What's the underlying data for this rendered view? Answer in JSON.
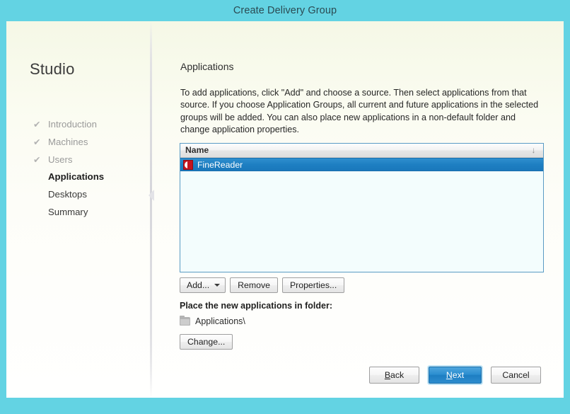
{
  "window": {
    "title": "Create Delivery Group",
    "titlebar_color": "#63d3e3",
    "accent_color": "#2b8ed0"
  },
  "sidebar": {
    "product_title": "Studio",
    "check_glyph": "✔",
    "items": [
      {
        "label": "Introduction",
        "state": "done"
      },
      {
        "label": "Machines",
        "state": "done"
      },
      {
        "label": "Users",
        "state": "done"
      },
      {
        "label": "Applications",
        "state": "current"
      },
      {
        "label": "Desktops",
        "state": "pending"
      },
      {
        "label": "Summary",
        "state": "pending"
      }
    ]
  },
  "main": {
    "heading": "Applications",
    "description": "To add applications, click \"Add\" and choose a source. Then select applications from that source. If you choose Application Groups, all current and future applications in the selected groups will be added. You can also place new applications in a non-default folder and change application properties.",
    "listview": {
      "column_header": "Name",
      "sort_glyph": "↓",
      "rows": [
        {
          "name": "FineReader",
          "icon": "finereader-app-icon",
          "selected": true
        }
      ]
    },
    "buttons": {
      "add": "Add...",
      "remove": "Remove",
      "properties": "Properties..."
    },
    "folder_section": {
      "label": "Place the new applications in folder:",
      "icon": "folder-icon",
      "path": "Applications\\",
      "change_button": "Change..."
    }
  },
  "footer": {
    "back": "Back",
    "back_accesskey": "B",
    "next": "Next",
    "next_accesskey": "N",
    "cancel": "Cancel"
  }
}
